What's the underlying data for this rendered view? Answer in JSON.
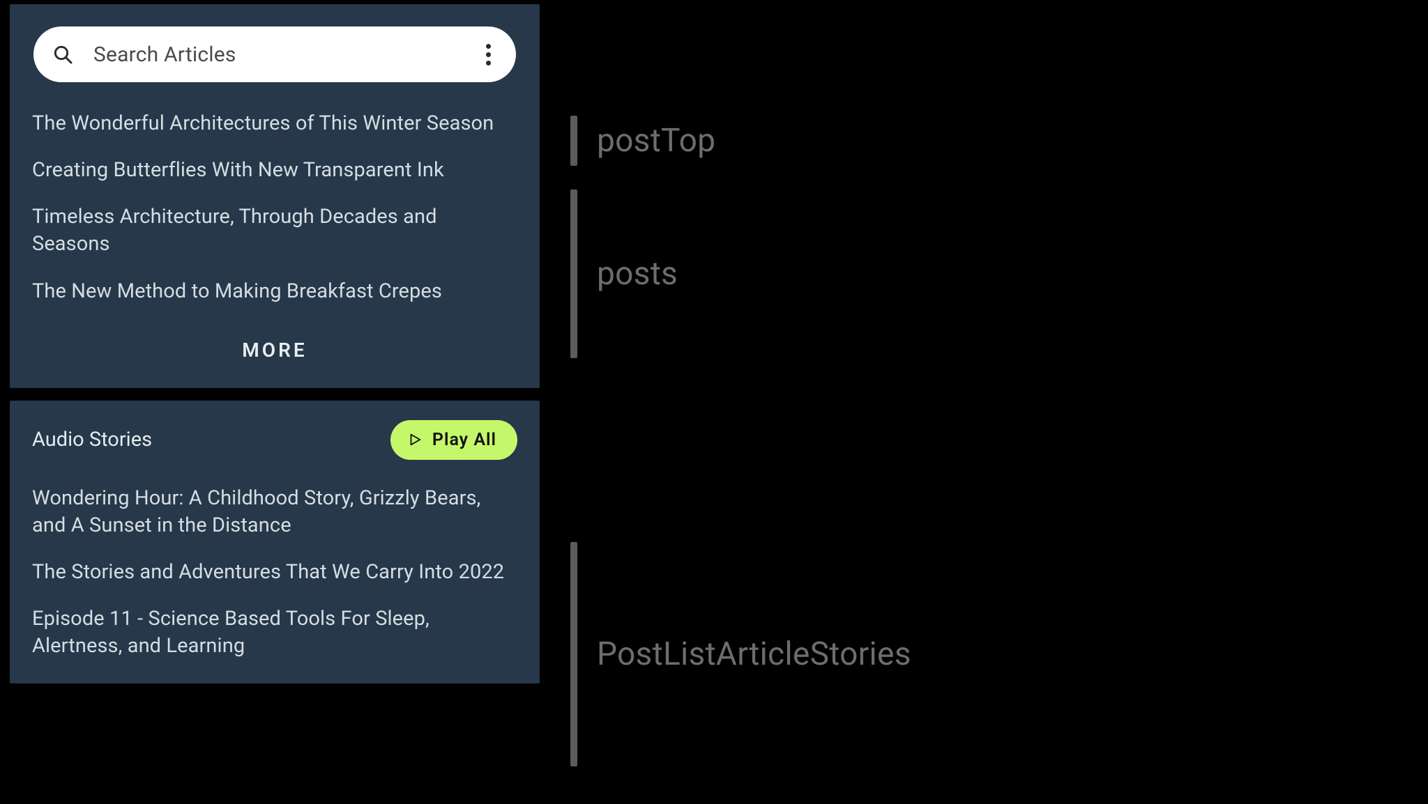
{
  "search": {
    "placeholder": "Search Articles"
  },
  "articles": {
    "items": [
      {
        "title": "The Wonderful Architectures of This Winter Season"
      },
      {
        "title": "Creating Butterflies With New Transparent Ink"
      },
      {
        "title": "Timeless Architecture, Through Decades and Seasons"
      },
      {
        "title": "The New Method to Making Breakfast Crepes"
      }
    ],
    "more_label": "MORE"
  },
  "stories": {
    "heading": "Audio Stories",
    "play_all_label": "Play All",
    "items": [
      {
        "title": "Wondering Hour: A Childhood Story, Grizzly Bears, and A Sunset in the Distance"
      },
      {
        "title": "The Stories and Adventures That We Carry Into 2022"
      },
      {
        "title": "Episode 11 - Science Based Tools For Sleep, Alertness, and Learning"
      }
    ]
  },
  "annotations": {
    "postTop": "postTop",
    "posts": "posts",
    "postListArticleStories": "PostListArticleStories"
  }
}
